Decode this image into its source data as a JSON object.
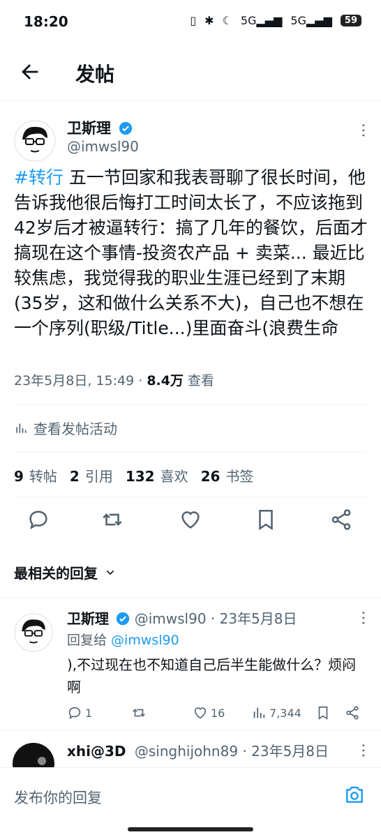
{
  "status_bar": {
    "time": "18:20",
    "icons": [
      "vibrate-icon",
      "bluetooth-icon",
      "moon-icon",
      "5g-signal-icon",
      "5g-signal-icon"
    ],
    "battery": "59"
  },
  "header": {
    "title": "发帖",
    "back_icon": "arrow-left-icon"
  },
  "tweet": {
    "author_name": "卫斯理",
    "author_handle": "@imwsl90",
    "hashtag": "#转行",
    "text": " 五一节回家和我表哥聊了很长时间，他告诉我他很后悔打工时间太长了，不应该拖到42岁后才被逼转行：搞了几年的餐饮，后面才搞现在这个事情-投资农产品 + 卖菜... 最近比较焦虑，我觉得我的职业生涯已经到了末期(35岁，这和做什么关系不大)，自己也不想在一个序列(职级/Title...)里面奋斗(浪费生命",
    "timestamp": "23年5月8日, 15:49 · ",
    "views_count": "8.4万",
    "views_label": " 查看",
    "analytics_label": "查看发帖活动",
    "stats": {
      "retweets": "9",
      "retweets_label": "转帖",
      "quotes": "2",
      "quotes_label": "引用",
      "likes": "132",
      "likes_label": "喜欢",
      "bookmarks": "26",
      "bookmarks_label": "书签"
    }
  },
  "replies_section": {
    "title": "最相关的回复"
  },
  "reply": {
    "author_name": "卫斯理",
    "meta": "@imwsl90 · 23年5月8日",
    "reply_to_label": "回复给 ",
    "reply_to_handle": "@imwsl90",
    "text": "),不过现在也不知道自己后半生能做什么？烦闷啊",
    "comments": "1",
    "likes": "16",
    "views": "7,344"
  },
  "reply2": {
    "author_name": "xhi@3D",
    "meta": "@singhijohn89 · 23年5月8日"
  },
  "composer": {
    "placeholder": "发布你的回复"
  },
  "colors": {
    "accent": "#1d9bf0",
    "muted": "#536471",
    "text": "#0f1419"
  }
}
